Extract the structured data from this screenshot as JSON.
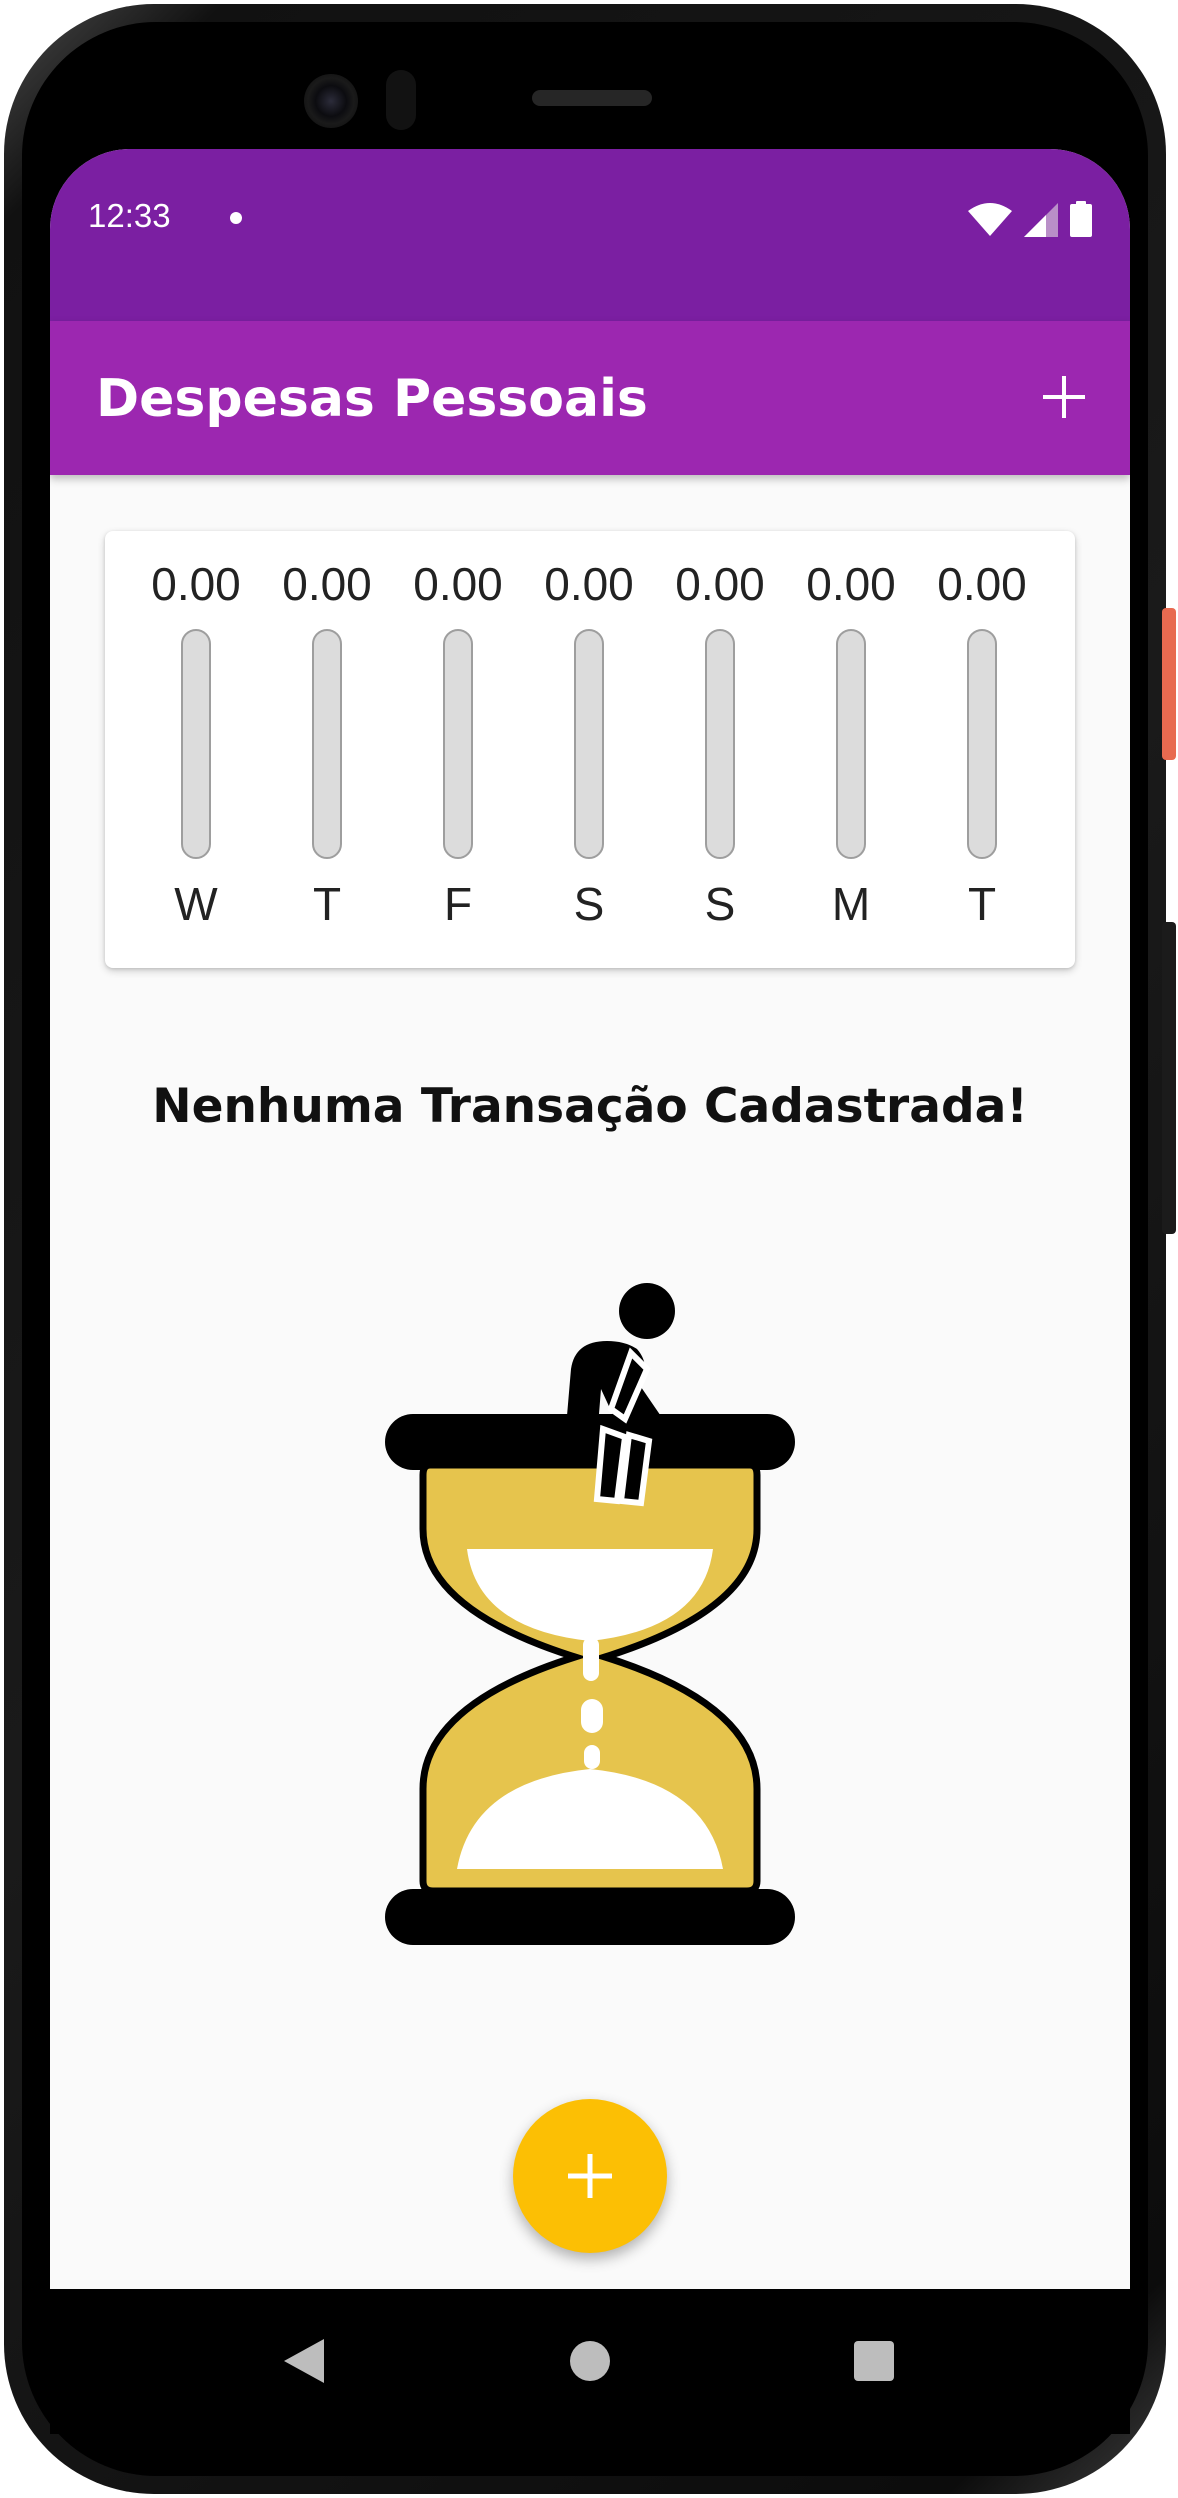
{
  "status_bar": {
    "time": "12:33"
  },
  "app_bar": {
    "title": "Despesas Pessoais",
    "add_icon": "plus-icon"
  },
  "chart_data": {
    "type": "bar",
    "categories": [
      "W",
      "T",
      "F",
      "S",
      "S",
      "M",
      "T"
    ],
    "values": [
      0.0,
      0.0,
      0.0,
      0.0,
      0.0,
      0.0,
      0.0
    ],
    "value_labels": [
      "0.00",
      "0.00",
      "0.00",
      "0.00",
      "0.00",
      "0.00",
      "0.00"
    ],
    "ylim": [
      0,
      1
    ],
    "bar_color": "#9c27b0",
    "track_color": "#dcdcdc"
  },
  "empty_state": {
    "message": "Nenhuma Transação Cadastrada!",
    "image_icon": "hourglass-waiting-icon"
  },
  "fab": {
    "icon": "plus-icon",
    "color": "#fcbf04"
  },
  "nav_bar": {
    "back_icon": "back-triangle-icon",
    "home_icon": "home-circle-icon",
    "recents_icon": "recents-square-icon"
  },
  "colors": {
    "primary": "#9c27b0",
    "primary_dark": "#7b1fa2",
    "accent": "#fcbf04",
    "hourglass_gold": "#e6c44d"
  }
}
